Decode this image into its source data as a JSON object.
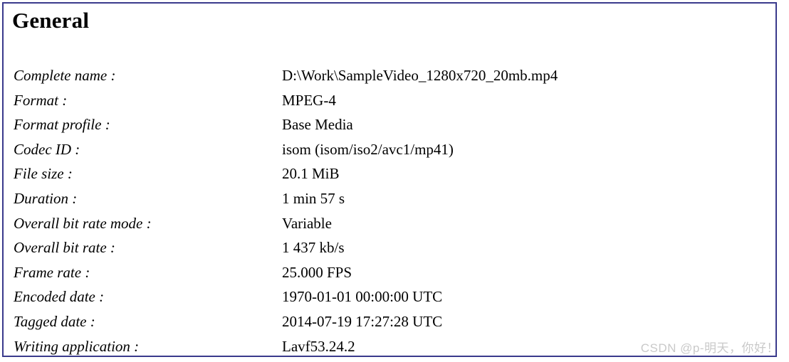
{
  "panel": {
    "section_title": "General",
    "border_color": "#3a3a8c",
    "background_color": "#ffffff",
    "text_color": "#000000"
  },
  "properties": [
    {
      "label": "Complete name :",
      "value": "D:\\Work\\SampleVideo_1280x720_20mb.mp4"
    },
    {
      "label": "Format :",
      "value": "MPEG-4"
    },
    {
      "label": "Format profile :",
      "value": "Base Media"
    },
    {
      "label": "Codec ID :",
      "value": "isom (isom/iso2/avc1/mp41)"
    },
    {
      "label": "File size :",
      "value": "20.1 MiB"
    },
    {
      "label": "Duration :",
      "value": "1 min 57 s"
    },
    {
      "label": "Overall bit rate mode :",
      "value": "Variable"
    },
    {
      "label": "Overall bit rate :",
      "value": "1 437 kb/s"
    },
    {
      "label": "Frame rate :",
      "value": "25.000 FPS"
    },
    {
      "label": "Encoded date :",
      "value": "1970-01-01 00:00:00 UTC"
    },
    {
      "label": "Tagged date :",
      "value": "2014-07-19 17:27:28 UTC"
    },
    {
      "label": "Writing application :",
      "value": "Lavf53.24.2"
    }
  ],
  "watermark": {
    "text": "CSDN @p-明天，你好！",
    "color": "#c9c9c9"
  }
}
